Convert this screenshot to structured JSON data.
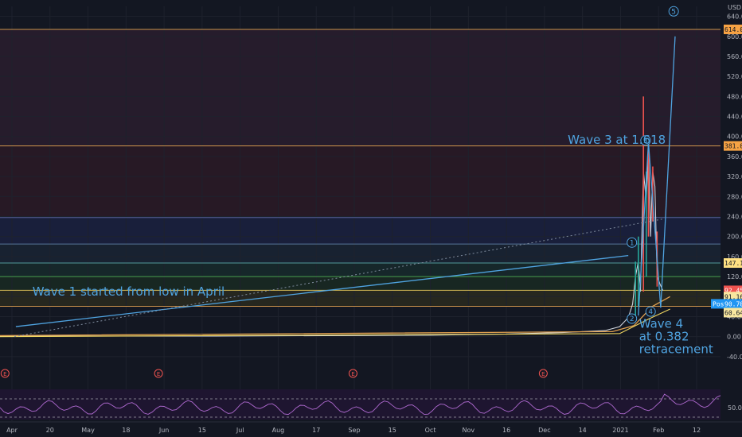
{
  "chart_data": {
    "type": "line",
    "currency": "USD",
    "y_ticks": [
      640,
      600,
      560,
      520,
      480,
      440,
      400,
      360,
      320,
      280,
      240,
      200,
      160,
      120,
      80,
      40,
      0,
      -40
    ],
    "y_tick_labels": [
      "640.00",
      "600.00",
      "560.00",
      "520.00",
      "480.00",
      "440.00",
      "400.00",
      "360.00",
      "320.00",
      "280.00",
      "240.00",
      "200.00",
      "160.00",
      "120.00",
      "80.00",
      "40.00",
      "0.00",
      "-40.00"
    ],
    "ylim": [
      -45,
      660
    ],
    "x_ticks": [
      "Apr",
      "20",
      "May",
      "18",
      "Jun",
      "15",
      "Jul",
      "Aug",
      "17",
      "Sep",
      "15",
      "Oct",
      "Nov",
      "16",
      "Dec",
      "14",
      "2021",
      "Feb",
      "12"
    ],
    "horizontal_levels": [
      {
        "value": 614.01,
        "color": "#e0a050"
      },
      {
        "value": 381.07,
        "color": "#e0a050"
      },
      {
        "value": 238.0,
        "color": "#5b6aa8"
      },
      {
        "value": 185.0,
        "color": "#5d7fa3"
      },
      {
        "value": 147.11,
        "color": "#58a6a6"
      },
      {
        "value": 120.0,
        "color": "#4caf50"
      },
      {
        "value": 92.45,
        "color": "#e6c85a"
      },
      {
        "value": 60.64,
        "color": "#e0a050"
      }
    ],
    "right_labels": [
      {
        "text": "614.01",
        "value": 614.01,
        "bg": "#f7a344",
        "fg": "#131722"
      },
      {
        "text": "381.07",
        "value": 381.07,
        "bg": "#f7a344",
        "fg": "#131722"
      },
      {
        "text": "147.11",
        "value": 147.11,
        "bg": "#ffe082",
        "fg": "#131722"
      },
      {
        "text": "92.45",
        "value": 92.45,
        "bg": "#ef5350",
        "fg": "#ffffff"
      },
      {
        "text": "91.16",
        "value": 80.0,
        "bg": "#f9e79f",
        "fg": "#131722"
      },
      {
        "text": "90.70",
        "value": 65.5,
        "bg": "#2196f3",
        "fg": "#ffffff",
        "prefix": "Post"
      },
      {
        "text": "60.64",
        "value": 48.0,
        "bg": "#f9e79f",
        "fg": "#131722"
      }
    ],
    "price_series": [
      {
        "x": 0.0,
        "y": 1
      },
      {
        "x": 0.3,
        "y": 1
      },
      {
        "x": 0.45,
        "y": 2
      },
      {
        "x": 0.6,
        "y": 3
      },
      {
        "x": 0.7,
        "y": 5
      },
      {
        "x": 0.78,
        "y": 8
      },
      {
        "x": 0.84,
        "y": 12
      },
      {
        "x": 0.86,
        "y": 20
      },
      {
        "x": 0.872,
        "y": 38
      },
      {
        "x": 0.878,
        "y": 65
      },
      {
        "x": 0.882,
        "y": 120
      },
      {
        "x": 0.886,
        "y": 150
      },
      {
        "x": 0.889,
        "y": 90
      },
      {
        "x": 0.893,
        "y": 330
      },
      {
        "x": 0.897,
        "y": 270
      },
      {
        "x": 0.9,
        "y": 380
      },
      {
        "x": 0.903,
        "y": 200
      },
      {
        "x": 0.906,
        "y": 330
      },
      {
        "x": 0.909,
        "y": 300
      },
      {
        "x": 0.912,
        "y": 120
      },
      {
        "x": 0.916,
        "y": 105
      },
      {
        "x": 0.92,
        "y": 92
      }
    ],
    "wave_lines": [
      {
        "from": [
          0.022,
          20
        ],
        "to": [
          0.872,
          162
        ]
      },
      {
        "from": [
          0.886,
          42
        ],
        "to": [
          0.9,
          388
        ]
      },
      {
        "from": [
          0.9,
          388
        ],
        "to": [
          0.917,
          58
        ]
      },
      {
        "from": [
          0.917,
          58
        ],
        "to": [
          0.937,
          600
        ]
      }
    ],
    "dashed_trend": {
      "from": [
        0.02,
        0
      ],
      "to": [
        0.92,
        235
      ]
    },
    "wave_points": [
      {
        "label": "1",
        "x": 0.877,
        "y": 188
      },
      {
        "label": "2",
        "x": 0.877,
        "y": 36
      },
      {
        "label": "3",
        "x": 0.896,
        "y": 392
      },
      {
        "label": "4",
        "x": 0.903,
        "y": 50
      },
      {
        "label": "5",
        "x": 0.935,
        "y": 650
      }
    ],
    "annotations": [
      {
        "id": "wave1",
        "text": "Wave 1 started from low in April",
        "x": 0.045,
        "y": 82,
        "lines": [
          "Wave 1 started from low in April"
        ]
      },
      {
        "id": "wave3",
        "text": "Wave 3 at 1.618",
        "x": 0.788,
        "y": 385,
        "lines": [
          "Wave 3 at 1.618"
        ]
      },
      {
        "id": "wave4",
        "text": "Wave 4 at 0.382 retracement",
        "x": 0.887,
        "y": 18,
        "lines": [
          "Wave 4",
          "at 0.382",
          "retracement"
        ]
      }
    ],
    "event_markers": [
      0.007,
      0.22,
      0.49,
      0.754
    ],
    "event_marker_label": "E",
    "rsi_label": "50.00"
  },
  "ui": {
    "currency_label": "USD",
    "post_label": "Post"
  }
}
